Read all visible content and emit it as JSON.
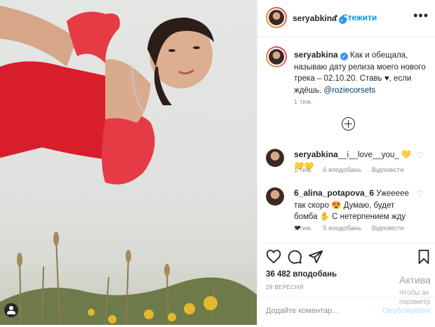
{
  "post": {
    "username": "seryabkina",
    "follow_label": "Стежити",
    "separator": "•",
    "caption": "Как и обещала, называю дату релиза моего нового трека – 02.10.20. Ставь ♥, если ждёшь. ",
    "caption_mention": "@roziecorsets",
    "caption_time": "1 тиж.",
    "likes": "36 482 вподобань",
    "date": "29 ВЕРЕСНЯ",
    "comment_placeholder": "Додайте коментар...",
    "publish_label": "Опублікувати"
  },
  "comments": [
    {
      "username": "seryabkina",
      "text": "__i__love__you_ 💛💛💛",
      "time": "1 тиж.",
      "likes": "6 вподобань",
      "reply": "Відповісти"
    },
    {
      "username": "6_alina_potapova_6",
      "text": "Ужееееe так скоро 😍 Думаю, будет бомба ✋ С нетерпением жду ❤",
      "time": "1 тиж.",
      "likes": "5 вподобань",
      "reply": "Відповісти"
    }
  ],
  "watermark": {
    "title": "Актива",
    "line1": "Чтобы ак",
    "line2": "параметр"
  },
  "icons": [
    "tag-user-icon",
    "verified-icon",
    "more-icon",
    "add-comment-icon",
    "heart-icon",
    "comment-icon",
    "share-icon",
    "bookmark-icon"
  ],
  "colors": {
    "accent": "#0095f6",
    "verified": "#3897f0",
    "dress": "#d81e2a"
  }
}
